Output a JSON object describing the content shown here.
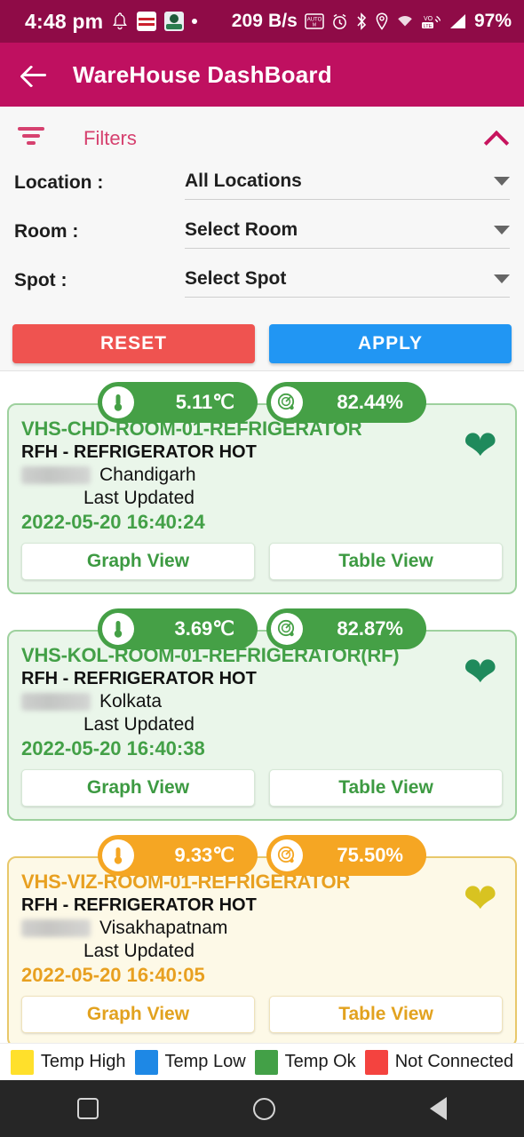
{
  "status_bar": {
    "time": "4:48 pm",
    "network_speed": "209 B/s",
    "battery": "97%",
    "icons_left": [
      "bell-icon",
      "zomato-app-icon",
      "app-icon",
      "dot-icon"
    ],
    "icons_right": [
      "auto-rotate-icon",
      "alarm-icon",
      "bluetooth-icon",
      "location-icon",
      "wifi-icon",
      "volte-icon",
      "signal-icon"
    ]
  },
  "app_bar": {
    "title": "WareHouse DashBoard",
    "back_icon": "arrow-left-icon",
    "background": "#bf1060"
  },
  "filters": {
    "title": "Filters",
    "funnel_icon": "filter-funnel-icon",
    "collapse_icon": "chevron-up-icon",
    "rows": [
      {
        "label": "Location :",
        "value": "All Locations"
      },
      {
        "label": "Room :",
        "value": "Select Room"
      },
      {
        "label": "Spot :",
        "value": "Select Spot"
      }
    ],
    "reset_label": "RESET",
    "apply_label": "APPLY",
    "reset_color": "#ef5350",
    "apply_color": "#2196f3"
  },
  "cards": [
    {
      "theme": "green",
      "temperature": "5.11℃",
      "humidity": "82.44%",
      "title": "VHS-CHD-ROOM-01-REFRIGERATOR",
      "subtitle": "RFH - REFRIGERATOR HOT",
      "city": "Chandigarh",
      "last_updated_label": "Last Updated",
      "timestamp": "2022-05-20  16:40:24",
      "graph_label": "Graph View",
      "table_label": "Table View",
      "favorite_icon": "heart-icon",
      "accent": "#43a047"
    },
    {
      "theme": "green",
      "temperature": "3.69℃",
      "humidity": "82.87%",
      "title": "VHS-KOL-ROOM-01-REFRIGERATOR(RF)",
      "subtitle": "RFH - REFRIGERATOR HOT",
      "city": "Kolkata",
      "last_updated_label": "Last Updated",
      "timestamp": "2022-05-20  16:40:38",
      "graph_label": "Graph View",
      "table_label": "Table View",
      "favorite_icon": "heart-icon",
      "accent": "#43a047"
    },
    {
      "theme": "orange",
      "temperature": "9.33℃",
      "humidity": "75.50%",
      "title": "VHS-VIZ-ROOM-01-REFRIGERATOR",
      "subtitle": "RFH - REFRIGERATOR HOT",
      "city": "Visakhapatnam",
      "last_updated_label": "Last Updated",
      "timestamp": "2022-05-20  16:40:05",
      "graph_label": "Graph View",
      "table_label": "Table View",
      "favorite_icon": "heart-icon",
      "accent": "#e8a020"
    }
  ],
  "legend": [
    {
      "label": "Temp High",
      "color": "#ffe02b"
    },
    {
      "label": "Temp Low",
      "color": "#1e88e5"
    },
    {
      "label": "Temp Ok",
      "color": "#43a047"
    },
    {
      "label": "Not Connected",
      "color": "#f4433f"
    }
  ],
  "nav_bar": {
    "recents_icon": "square-recents-icon",
    "home_icon": "circle-home-icon",
    "back_icon": "triangle-back-icon"
  }
}
